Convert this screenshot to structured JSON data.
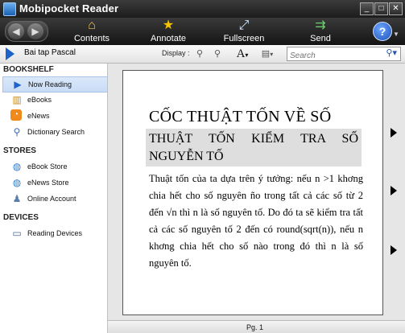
{
  "window": {
    "title": "Mobipocket Reader",
    "minimize": "_",
    "maximize": "□",
    "close": "✕"
  },
  "toolbar": {
    "back_icon": "◀",
    "forward_icon": "▶",
    "buttons": [
      {
        "label": "Contents",
        "icon": "house-icon",
        "glyph": "⌂",
        "color": "#f0c25a"
      },
      {
        "label": "Annotate",
        "icon": "star-icon",
        "glyph": "★",
        "color": "#f5c400"
      },
      {
        "label": "Fullscreen",
        "icon": "fullscreen-icon",
        "glyph": "⤢",
        "color": "#cfe4ff"
      },
      {
        "label": "Send",
        "icon": "send-icon",
        "glyph": "⇉",
        "color": "#6ad06a"
      }
    ],
    "help": "?"
  },
  "subbar": {
    "book_title": "Bai tap Pascal",
    "display_label": "Display :",
    "font_glyph": "A",
    "search_placeholder": "Search"
  },
  "sidebar": {
    "sections": [
      {
        "heading": "BOOKSHELF",
        "items": [
          {
            "label": "Now Reading",
            "icon": "play-icon",
            "active": true
          },
          {
            "label": "eBooks",
            "icon": "books-icon"
          },
          {
            "label": "eNews",
            "icon": "rss-icon"
          },
          {
            "label": "Dictionary Search",
            "icon": "magnifier-icon"
          }
        ]
      },
      {
        "heading": "STORES",
        "items": [
          {
            "label": "eBook Store",
            "icon": "globe-icon"
          },
          {
            "label": "eNews Store",
            "icon": "globe-icon"
          },
          {
            "label": "Online Account",
            "icon": "users-icon"
          }
        ]
      },
      {
        "heading": "DEVICES",
        "items": [
          {
            "label": "Reading Devices",
            "icon": "device-icon"
          }
        ]
      }
    ]
  },
  "page": {
    "heading": "CỐC THUẬT TỐN VỀ SỐ",
    "subheading": "THUẬT TỐN KIỂM TRA SỐ NGUYỄN TỐ",
    "body": "Thuật tốn của ta  dựa trên ý tưởng: nếu n >1 khơng chia hết cho số nguyên ño trong tất cả các số từ 2 đến √n thì n là số nguyên tố. Do đó ta sẽ kiểm tra tất cả các số nguyên tố 2 đến có round(sqrt(n)), nếu n khơng chia hết cho số nào trong đó thì n là số nguyên tố."
  },
  "status": {
    "page_number": "Pg. 1"
  }
}
